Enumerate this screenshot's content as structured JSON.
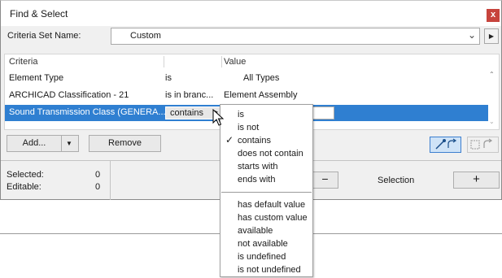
{
  "dialog": {
    "title": "Find & Select",
    "close_glyph": "x",
    "criteria_set_label": "Criteria Set Name:",
    "criteria_set_value": "Custom",
    "dropdown_icon": "chevron-down-icon",
    "next_icon": "triangle-right-icon"
  },
  "table": {
    "headers": {
      "criteria": "Criteria",
      "value": "Value"
    },
    "rows": [
      {
        "criteria": "Element Type",
        "operator": "is",
        "value": "All Types"
      },
      {
        "criteria": "ARCHICAD Classification - 21",
        "operator": "is in branc...",
        "value": "Element Assembly"
      },
      {
        "criteria": "Sound Transmission Class (GENERA...",
        "operator": "contains",
        "value": ""
      }
    ],
    "selected_row": 2
  },
  "buttons": {
    "add": "Add...",
    "remove": "Remove",
    "minus": "−",
    "plus": "+"
  },
  "status": {
    "selected_label": "Selected:",
    "selected_value": "0",
    "editable_label": "Editable:",
    "editable_value": "0",
    "selection_label": "Selection"
  },
  "menu": {
    "group1": [
      "is",
      "is not",
      "contains",
      "does not contain",
      "starts with",
      "ends with"
    ],
    "group2": [
      "has default value",
      "has custom value",
      "available",
      "not available",
      "is undefined",
      "is not undefined"
    ],
    "checked": "contains"
  },
  "colors": {
    "selection": "#2f7fd1",
    "close": "#c7443d",
    "tool_active": "#cfe3f7"
  }
}
